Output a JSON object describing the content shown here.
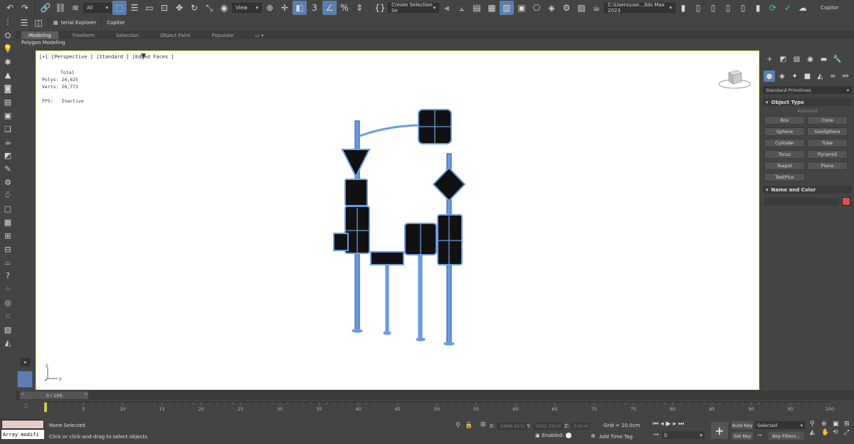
{
  "toolbar": {
    "filter_select": "All",
    "ref_coord": "View",
    "create_selection_set": "Create Selection Se",
    "path_dropdown": "C:\\Users\\use...3ds Max 2023",
    "copitor_label": "Copitor"
  },
  "second_toolbar": {
    "material_explorer": "terial Explorer",
    "copitor": "Copitor"
  },
  "ribbon": {
    "tabs": [
      "Modeling",
      "Freeform",
      "Selection",
      "Object Paint",
      "Populate"
    ],
    "panel_label": "Polygon Modeling"
  },
  "viewport": {
    "label": "[+] [Perspective ] [Standard ] [Edged Faces ]",
    "stats_header": "Total",
    "polys_label": "Polys:",
    "polys_value": "24,625",
    "verts_label": "Verts:",
    "verts_value": "26,773",
    "fps_label": "FPS:",
    "fps_value": "Inactive"
  },
  "command_panel": {
    "category": "Standard Primitives",
    "object_type_title": "Object Type",
    "autogrid": "AutoGrid",
    "primitives": [
      "Box",
      "Cone",
      "Sphere",
      "GeoSphere",
      "Cylinder",
      "Tube",
      "Torus",
      "Pyramid",
      "Teapot",
      "Plane",
      "TextPlus"
    ],
    "name_color_title": "Name and Color",
    "color": "#d9534f"
  },
  "timeline": {
    "slider": "0 / 100",
    "ticks": [
      "5",
      "10",
      "15",
      "20",
      "25",
      "30",
      "35",
      "40",
      "45",
      "50",
      "55",
      "60",
      "65",
      "70",
      "75",
      "80",
      "85",
      "90",
      "95",
      "100"
    ]
  },
  "status": {
    "maxscript_output": "Array modifi",
    "selection": "None Selected",
    "prompt": "Click or click-and-drag to select objects",
    "x_label": "X:",
    "x_value": "-5896.427c",
    "y_label": "Y:",
    "y_value": "1502.35cm",
    "z_label": "Z:",
    "z_value": "0.0cm",
    "grid": "Grid = 10.0cm",
    "enabled": "Enabled:",
    "add_time_tag": "Add Time Tag",
    "frame": "0",
    "auto_key": "Auto Key",
    "set_key": "Set Key",
    "selected_dd": "Selected",
    "key_filters": "Key Filters..."
  },
  "colors": {
    "ui_bg": "#444444",
    "accent": "#5a7fb0",
    "wire_blue": "#6b9be0",
    "sign_black": "#111111"
  }
}
